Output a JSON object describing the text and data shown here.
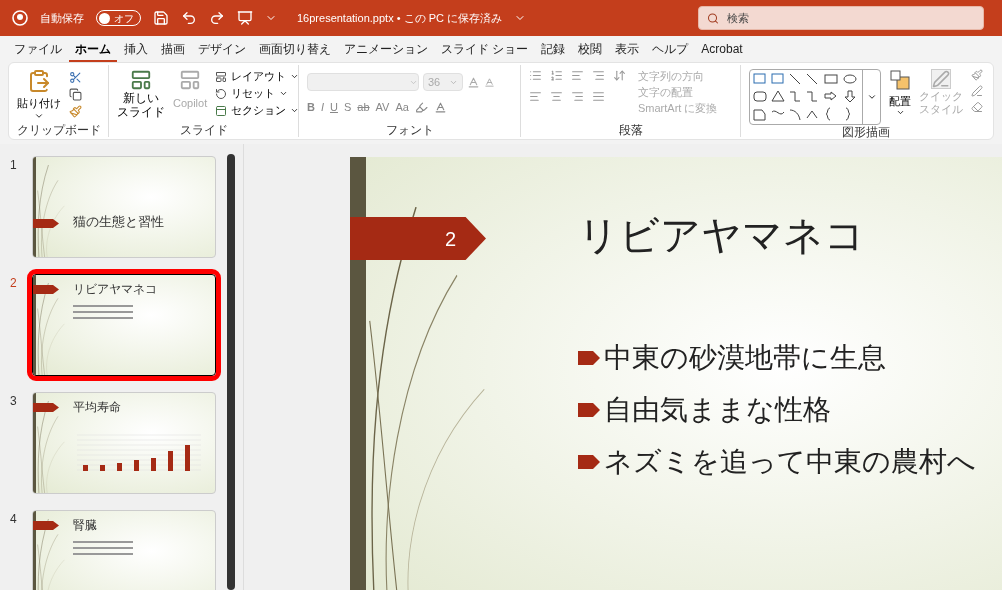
{
  "title_bar": {
    "autosave_label": "自動保存",
    "autosave": {
      "on": false,
      "label": "オフ"
    },
    "filename": "16presentation.pptx • この PC に保存済み",
    "search": {
      "placeholder": "検索"
    }
  },
  "tabs": [
    {
      "label": "ファイル",
      "selected": false
    },
    {
      "label": "ホーム",
      "selected": true
    },
    {
      "label": "挿入",
      "selected": false
    },
    {
      "label": "描画",
      "selected": false
    },
    {
      "label": "デザイン",
      "selected": false
    },
    {
      "label": "画面切り替え",
      "selected": false
    },
    {
      "label": "アニメーション",
      "selected": false
    },
    {
      "label": "スライド ショー",
      "selected": false
    },
    {
      "label": "記録",
      "selected": false
    },
    {
      "label": "校閲",
      "selected": false
    },
    {
      "label": "表示",
      "selected": false
    },
    {
      "label": "ヘルプ",
      "selected": false
    },
    {
      "label": "Acrobat",
      "selected": false
    }
  ],
  "ribbon": [
    {
      "kind": "clipboard",
      "label": "クリップボード",
      "paste": "貼り付け"
    },
    {
      "kind": "slides",
      "label": "スライド",
      "new_slide": [
        "新しい",
        "スライド"
      ],
      "copilot": {
        "label": "Copilot",
        "disabled": true
      },
      "menu": [
        "レイアウト",
        "リセット",
        "セクション"
      ]
    },
    {
      "kind": "font",
      "label": "フォント",
      "font_size": {
        "value": "36",
        "disabled": true
      },
      "format_buttons": [
        "B",
        "I",
        "U",
        "S",
        "ab",
        "AV",
        "Aa"
      ]
    },
    {
      "kind": "paragraph",
      "label": "段落",
      "commands": [
        {
          "label": "文字列の方向",
          "disabled": true
        },
        {
          "label": "文字の配置",
          "disabled": true
        },
        {
          "label": "SmartArt に変換",
          "disabled": true
        }
      ]
    },
    {
      "kind": "drawing",
      "label": "図形描画",
      "arrange": "配置",
      "quick_style": {
        "label": [
          "クイック",
          "スタイル"
        ],
        "disabled": true
      }
    }
  ],
  "thumbnails": [
    {
      "number": "1",
      "title": "猫の生態と習性",
      "kind": "title",
      "selected": false
    },
    {
      "number": "2",
      "title": "リビアヤマネコ",
      "kind": "bullets",
      "selected": true
    },
    {
      "number": "3",
      "title": "平均寿命",
      "kind": "chart",
      "selected": false
    },
    {
      "number": "4",
      "title": "腎臓",
      "kind": "bullets",
      "selected": false
    }
  ],
  "slide": {
    "number": "2",
    "title": "リビアヤマネコ",
    "bullets": [
      "中東の砂漠地帯に生息",
      "自由気ままな性格",
      "ネズミを追って中東の農村へ"
    ]
  }
}
